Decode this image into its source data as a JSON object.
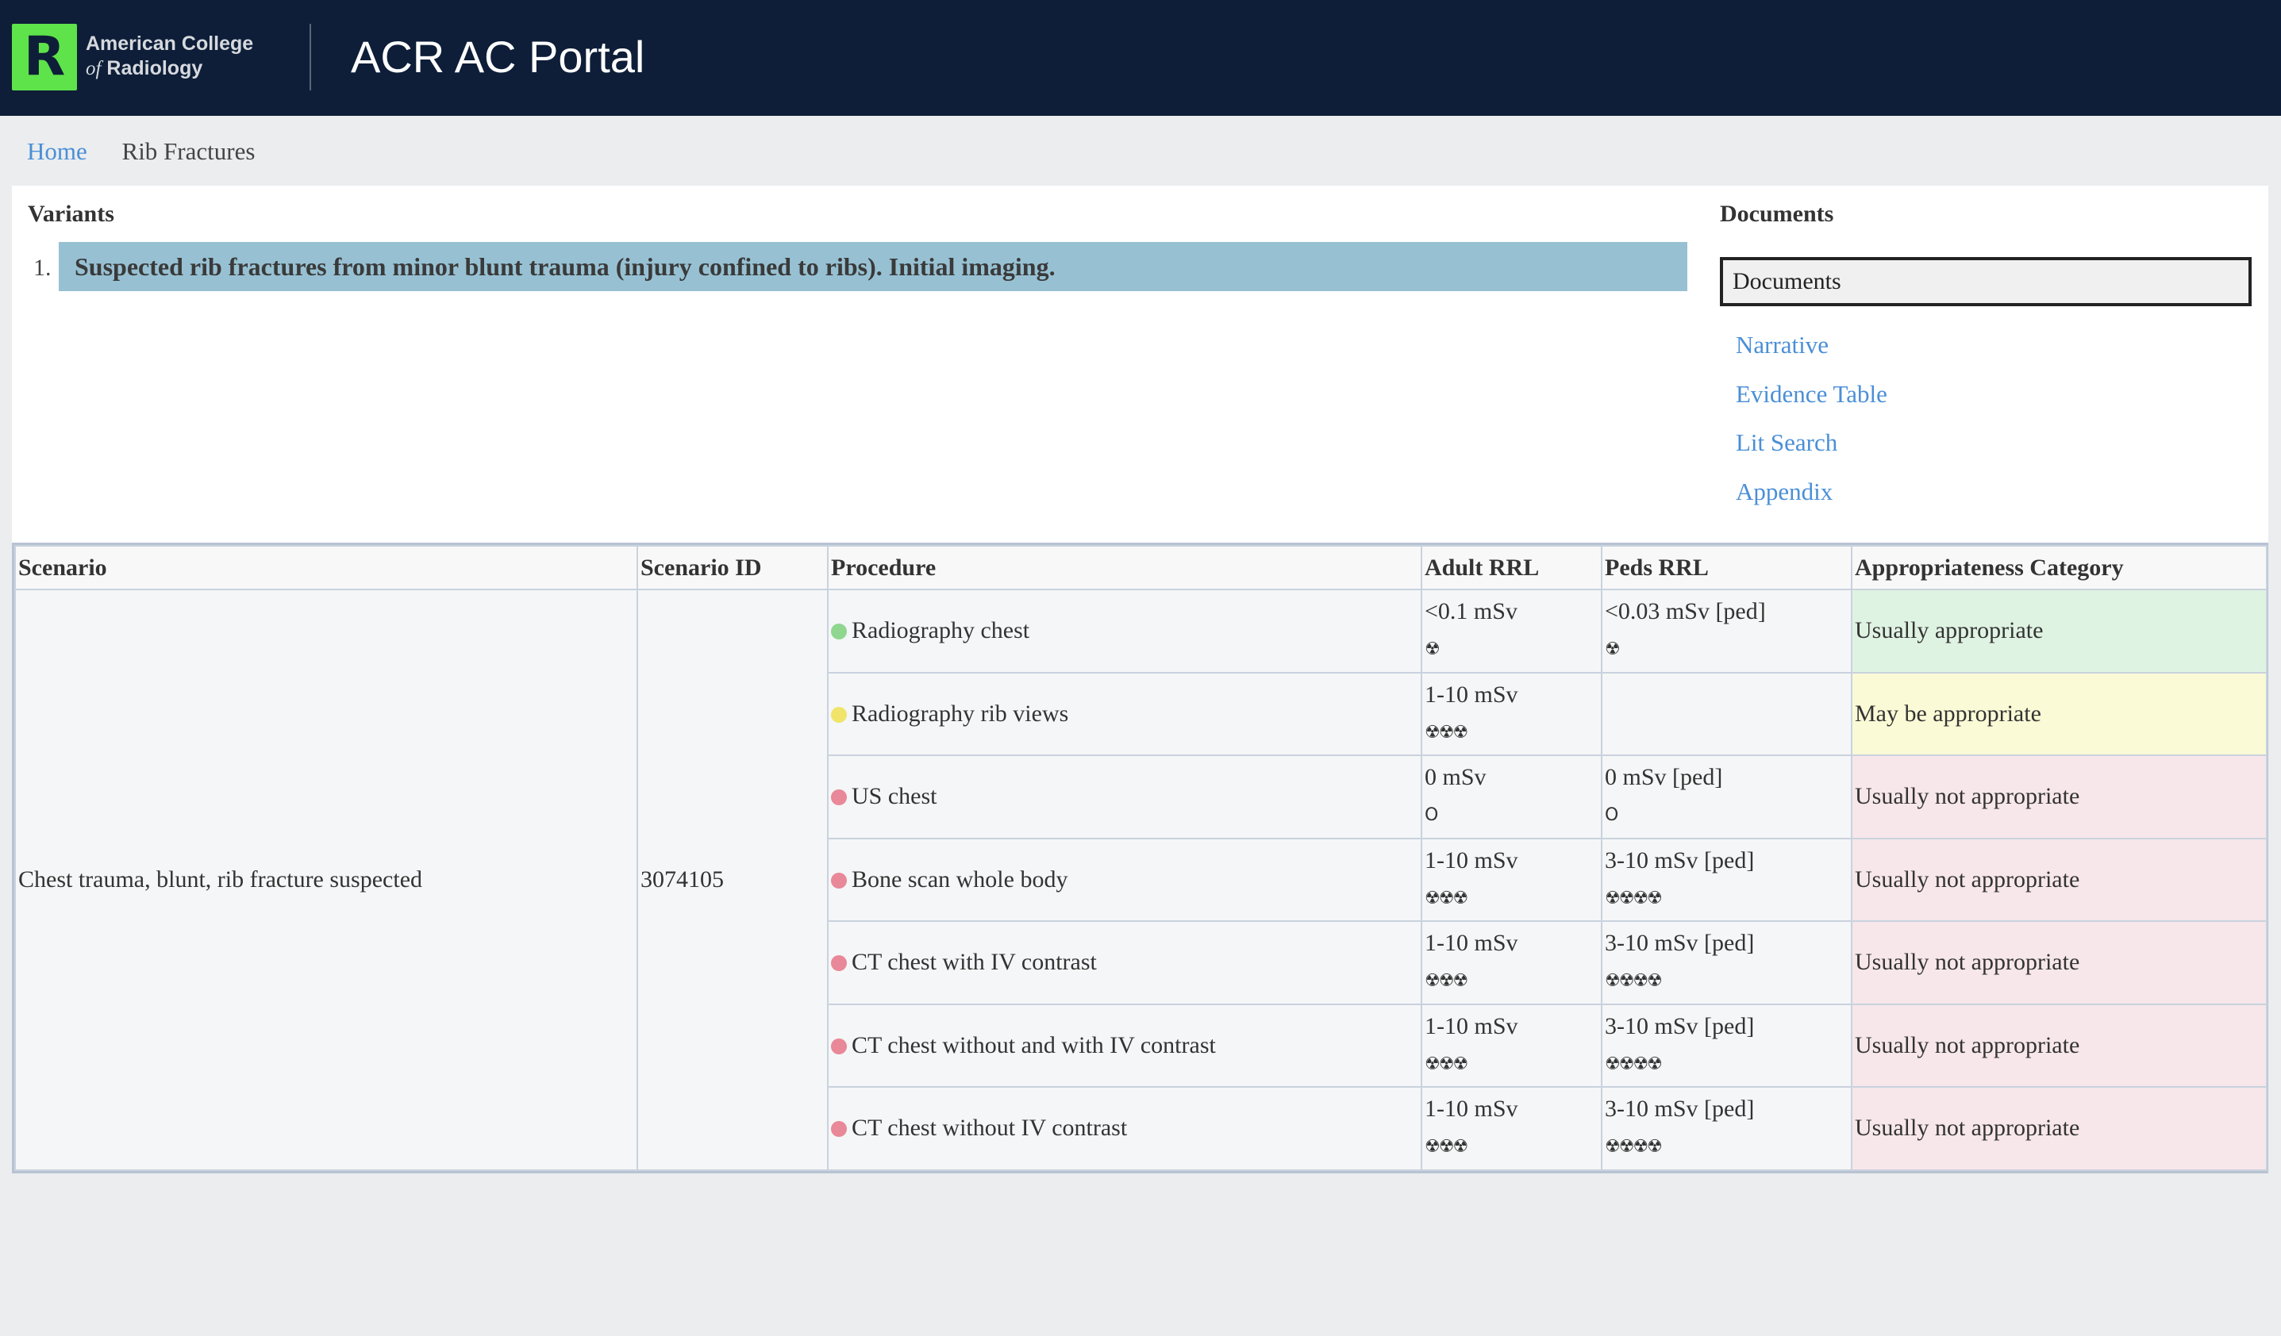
{
  "header": {
    "logo_letter": "R",
    "org_line1": "American College",
    "org_line2_of": "of",
    "org_line2_rest": "Radiology",
    "app_title": "ACR AC Portal"
  },
  "breadcrumb": {
    "home": "Home",
    "current": "Rib Fractures"
  },
  "variants": {
    "title": "Variants",
    "items": [
      {
        "number": "1.",
        "label": "Suspected rib fractures from minor blunt trauma (injury confined to ribs). Initial imaging."
      }
    ]
  },
  "documents": {
    "title": "Documents",
    "select_value": "Documents",
    "links": [
      "Narrative",
      "Evidence Table",
      "Lit Search",
      "Appendix"
    ]
  },
  "table": {
    "headers": [
      "Scenario",
      "Scenario ID",
      "Procedure",
      "Adult RRL",
      "Peds RRL",
      "Appropriateness Category"
    ],
    "scenario": "Chest trauma, blunt, rib fracture suspected",
    "scenario_id": "3074105",
    "rows": [
      {
        "procedure": "Radiography chest",
        "adult_dose": "<0.1 mSv",
        "adult_icon": "☢",
        "peds_dose": "<0.03 mSv [ped]",
        "peds_icon": "☢",
        "category": "Usually appropriate",
        "dot_color": "#8fd68f",
        "category_color": "#dff3e2"
      },
      {
        "procedure": "Radiography rib views",
        "adult_dose": "1-10 mSv",
        "adult_icon": "☢☢☢",
        "peds_dose": "",
        "peds_icon": "",
        "category": "May be appropriate",
        "dot_color": "#f0e46a",
        "category_color": "#fafad6"
      },
      {
        "procedure": "US chest",
        "adult_dose": "0 mSv",
        "adult_icon": "O",
        "peds_dose": "0 mSv [ped]",
        "peds_icon": "O",
        "category": "Usually not appropriate",
        "dot_color": "#e88898",
        "category_color": "#f7e7ea"
      },
      {
        "procedure": "Bone scan whole body",
        "adult_dose": "1-10 mSv",
        "adult_icon": "☢☢☢",
        "peds_dose": "3-10 mSv [ped]",
        "peds_icon": "☢☢☢☢",
        "category": "Usually not appropriate",
        "dot_color": "#e88898",
        "category_color": "#f7e7ea"
      },
      {
        "procedure": "CT chest with IV contrast",
        "adult_dose": "1-10 mSv",
        "adult_icon": "☢☢☢",
        "peds_dose": "3-10 mSv [ped]",
        "peds_icon": "☢☢☢☢",
        "category": "Usually not appropriate",
        "dot_color": "#e88898",
        "category_color": "#f7e7ea"
      },
      {
        "procedure": "CT chest without and with IV contrast",
        "adult_dose": "1-10 mSv",
        "adult_icon": "☢☢☢",
        "peds_dose": "3-10 mSv [ped]",
        "peds_icon": "☢☢☢☢",
        "category": "Usually not appropriate",
        "dot_color": "#e88898",
        "category_color": "#f7e7ea"
      },
      {
        "procedure": "CT chest without IV contrast",
        "adult_dose": "1-10 mSv",
        "adult_icon": "☢☢☢",
        "peds_dose": "3-10 mSv [ped]",
        "peds_icon": "☢☢☢☢",
        "category": "Usually not appropriate",
        "dot_color": "#e88898",
        "category_color": "#f7e7ea"
      }
    ]
  }
}
